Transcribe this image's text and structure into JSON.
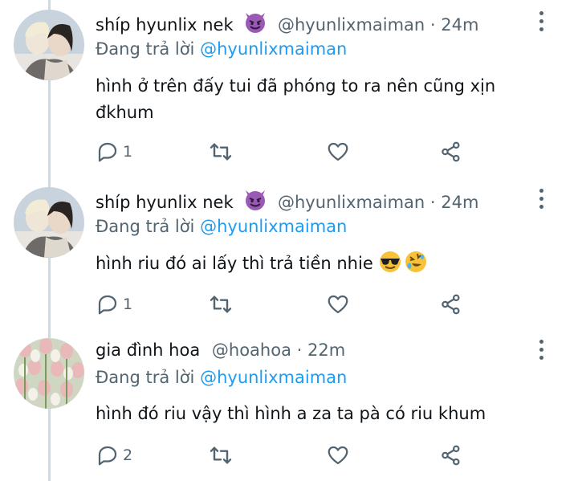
{
  "tweets": [
    {
      "name": "shíp hyunlix nek",
      "name_emoji": "smiling-face-with-horns-emoji",
      "handle": "@hyunlixmaiman",
      "dot": "·",
      "time": "24m",
      "replying_prefix": "Đang trả lời",
      "replying_to": "@hyunlixmaiman",
      "text": "hình ở trên đấy tui đã phóng to ra nên cũng xịn đkhum",
      "reply_count": "1"
    },
    {
      "name": "shíp hyunlix nek",
      "name_emoji": "smiling-face-with-horns-emoji",
      "handle": "@hyunlixmaiman",
      "dot": "·",
      "time": "24m",
      "replying_prefix": "Đang trả lời",
      "replying_to": "@hyunlixmaiman",
      "text": "hình riu đó ai lấy thì trả tiền nhie",
      "text_emojis": [
        "sunglasses-face-emoji",
        "rolling-laughing-emoji"
      ],
      "reply_count": "1"
    },
    {
      "name": "gia đình hoa",
      "handle": "@hoahoa",
      "dot": "·",
      "time": "22m",
      "replying_prefix": "Đang trả lời",
      "replying_to": "@hyunlixmaiman",
      "text": "hình đó riu vậy thì hình a za ta pà có riu khum",
      "reply_count": "2"
    }
  ],
  "colors": {
    "text": "#0f1419",
    "muted": "#536471",
    "link": "#1d9bf0",
    "thread_line": "#cfd9de"
  }
}
